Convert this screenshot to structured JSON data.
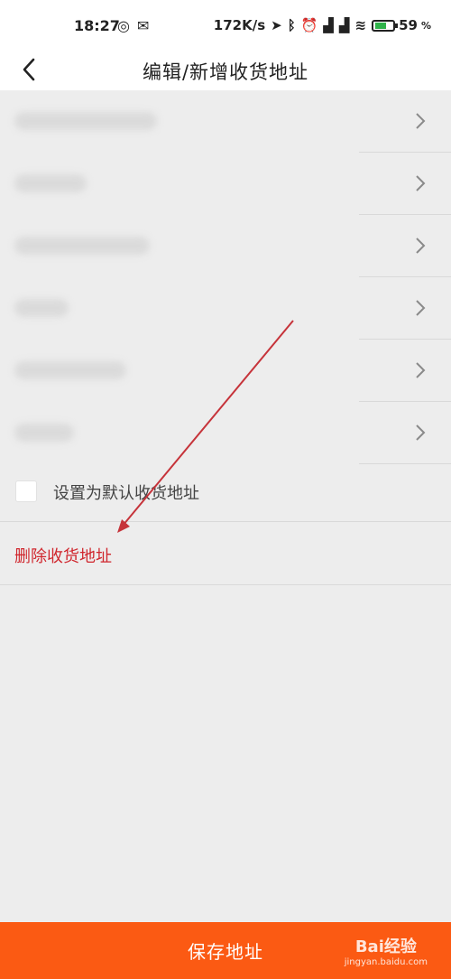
{
  "status_bar": {
    "time": "18:27",
    "speed": "172K/s",
    "battery": "59",
    "battery_unit": "%"
  },
  "header": {
    "title": "编辑/新增收货地址"
  },
  "form_rows": [
    {
      "placeholder": ""
    },
    {
      "placeholder": ""
    },
    {
      "placeholder": ""
    },
    {
      "placeholder": ""
    },
    {
      "placeholder": ""
    },
    {
      "placeholder": ""
    }
  ],
  "default_option": {
    "label": "设置为默认收货地址",
    "checked": false
  },
  "delete_action": {
    "label": "删除收货地址"
  },
  "save_button": {
    "label": "保存地址"
  },
  "watermark": {
    "brand": "Bai经验",
    "domain": "jingyan.baidu.com"
  },
  "colors": {
    "accent": "#fb5a13",
    "danger": "#d0262d",
    "arrow": "#c6333a"
  }
}
